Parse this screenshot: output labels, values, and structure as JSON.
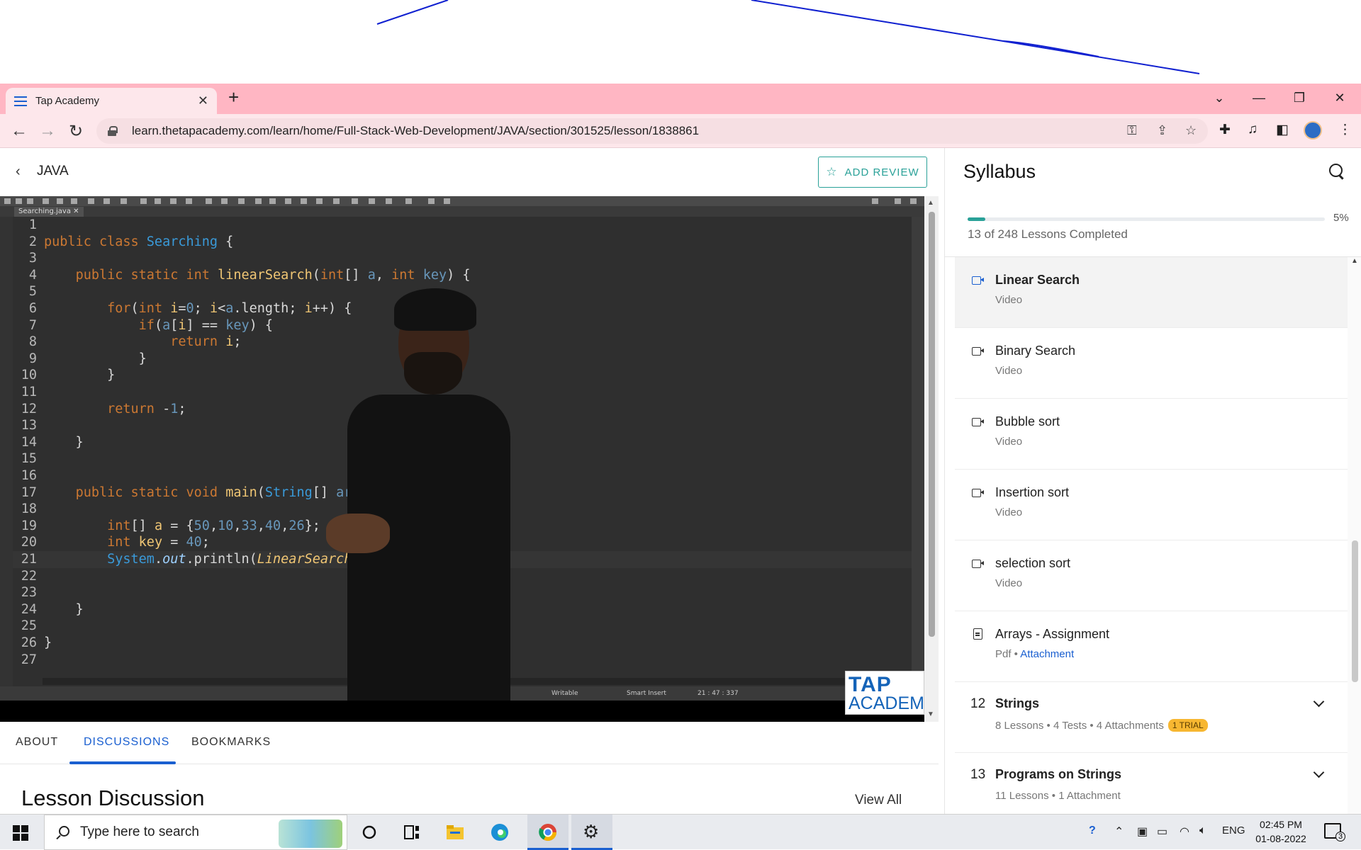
{
  "browser": {
    "tab_title": "Tap Academy",
    "url": "learn.thetapacademy.com/learn/home/Full-Stack-Web-Development/JAVA/section/301525/lesson/1838861"
  },
  "header": {
    "course": "JAVA",
    "add_review": "ADD REVIEW"
  },
  "video": {
    "file_tab": "Searching.java",
    "status": {
      "writable": "Writable",
      "insert": "Smart Insert",
      "position": "21 : 47 : 337"
    },
    "logo_top": "TAP",
    "logo_bottom": "ACADEMY"
  },
  "code_lines": [
    "1",
    "2",
    "3",
    "4",
    "5",
    "6",
    "7",
    "8",
    "9",
    "10",
    "11",
    "12",
    "13",
    "14",
    "15",
    "16",
    "17",
    "18",
    "19",
    "20",
    "21",
    "22",
    "23",
    "24",
    "25",
    "26",
    "27"
  ],
  "tabs": {
    "about": "ABOUT",
    "discussions": "DISCUSSIONS",
    "bookmarks": "BOOKMARKS"
  },
  "discussion": {
    "title": "Lesson Discussion",
    "view_all": "View All"
  },
  "syllabus": {
    "title": "Syllabus",
    "progress_pct": "5%",
    "progress_value": 0.05,
    "progress_text": "13 of 248 Lessons Completed",
    "items": [
      {
        "name": "Linear Search",
        "sub": "Video"
      },
      {
        "name": "Binary Search",
        "sub": "Video"
      },
      {
        "name": "Bubble sort",
        "sub": "Video"
      },
      {
        "name": "Insertion sort",
        "sub": "Video"
      },
      {
        "name": "selection sort",
        "sub": "Video"
      },
      {
        "name": "Arrays - Assignment",
        "sub": "Pdf •",
        "attach": "Attachment"
      }
    ],
    "sections": [
      {
        "num": "12",
        "name": "Strings",
        "sub": "8 Lessons • 4 Tests • 4 Attachments",
        "badge": "1 TRIAL"
      },
      {
        "num": "13",
        "name": "Programs on Strings",
        "sub": "11 Lessons • 1 Attachment"
      }
    ]
  },
  "taskbar": {
    "search_placeholder": "Type here to search",
    "lang": "ENG",
    "time": "02:45 PM",
    "date": "01-08-2022",
    "notif_count": "3"
  },
  "colors": {
    "accent": "#2aa198",
    "link": "#1a5fd0",
    "chrome": "#ffb6c3"
  }
}
